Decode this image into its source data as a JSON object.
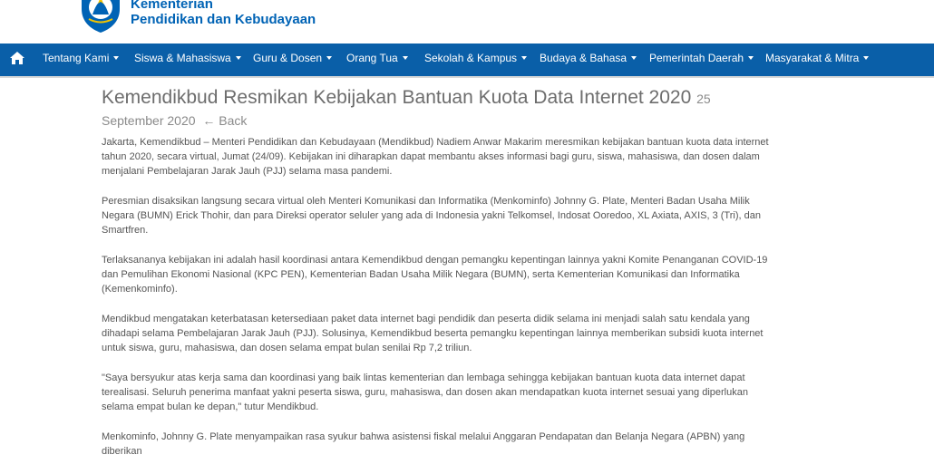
{
  "brand": {
    "line1": "Kementerian",
    "line2": "Pendidikan dan Kebudayaan"
  },
  "colors": {
    "nav_bg": "#0a5fa8",
    "brand": "#0063b5",
    "text": "#555555"
  },
  "nav": {
    "home_icon": "home-icon",
    "items": [
      {
        "label": "Tentang Kami"
      },
      {
        "label": "Siswa & Mahasiswa"
      },
      {
        "label": "Guru & Dosen"
      },
      {
        "label": "Orang Tua"
      },
      {
        "label": "Sekolah & Kampus"
      },
      {
        "label": "Budaya & Bahasa"
      },
      {
        "label": "Pemerintah Daerah"
      },
      {
        "label": "Masyarakat & Mitra"
      }
    ]
  },
  "article": {
    "title": "Kemendikbud Resmikan Kebijakan Bantuan Kuota Data Internet 2020",
    "date_day": "25",
    "date_rest": "September 2020",
    "back_label": "← Back",
    "paragraphs": [
      "Jakarta, Kemendikbud – Menteri Pendidikan dan Kebudayaan (Mendikbud) Nadiem Anwar Makarim meresmikan kebijakan bantuan kuota data internet tahun 2020, secara virtual, Jumat (24/09). Kebijakan ini diharapkan dapat membantu akses informasi bagi guru, siswa, mahasiswa, dan dosen dalam menjalani Pembelajaran Jarak Jauh (PJJ) selama masa pandemi.",
      "Peresmian disaksikan langsung secara virtual oleh Menteri Komunikasi dan Informatika (Menkominfo) Johnny G. Plate, Menteri Badan Usaha Milik Negara (BUMN) Erick Thohir, dan para Direksi operator seluler yang ada di Indonesia yakni Telkomsel, Indosat Ooredoo, XL Axiata, AXIS, 3 (Tri), dan Smartfren.",
      "Terlaksananya kebijakan ini adalah hasil koordinasi antara Kemendikbud dengan pemangku kepentingan lainnya yakni Komite Penanganan COVID-19 dan Pemulihan Ekonomi Nasional (KPC PEN), Kementerian Badan Usaha Milik Negara (BUMN), serta Kementerian Komunikasi dan Informatika (Kemenkominfo).",
      "Mendikbud mengatakan keterbatasan ketersediaan paket data internet bagi pendidik dan peserta didik selama ini menjadi salah satu kendala yang dihadapi selama Pembelajaran Jarak Jauh (PJJ). Solusinya, Kemendikbud beserta pemangku kepentingan lainnya memberikan subsidi kuota internet untuk siswa, guru, mahasiswa, dan dosen selama empat bulan senilai Rp 7,2 triliun.",
      "\"Saya bersyukur atas kerja sama dan koordinasi yang baik lintas kementerian dan lembaga sehingga kebijakan bantuan kuota data internet dapat terealisasi. Seluruh penerima manfaat yakni peserta siswa, guru, mahasiswa, dan dosen akan mendapatkan kuota internet sesuai yang diperlukan selama empat bulan ke depan,\" tutur Mendikbud.",
      "Menkominfo, Johnny G. Plate menyampaikan rasa syukur bahwa asistensi fiskal melalui Anggaran Pendapatan dan Belanja Negara (APBN) yang diberikan"
    ]
  }
}
